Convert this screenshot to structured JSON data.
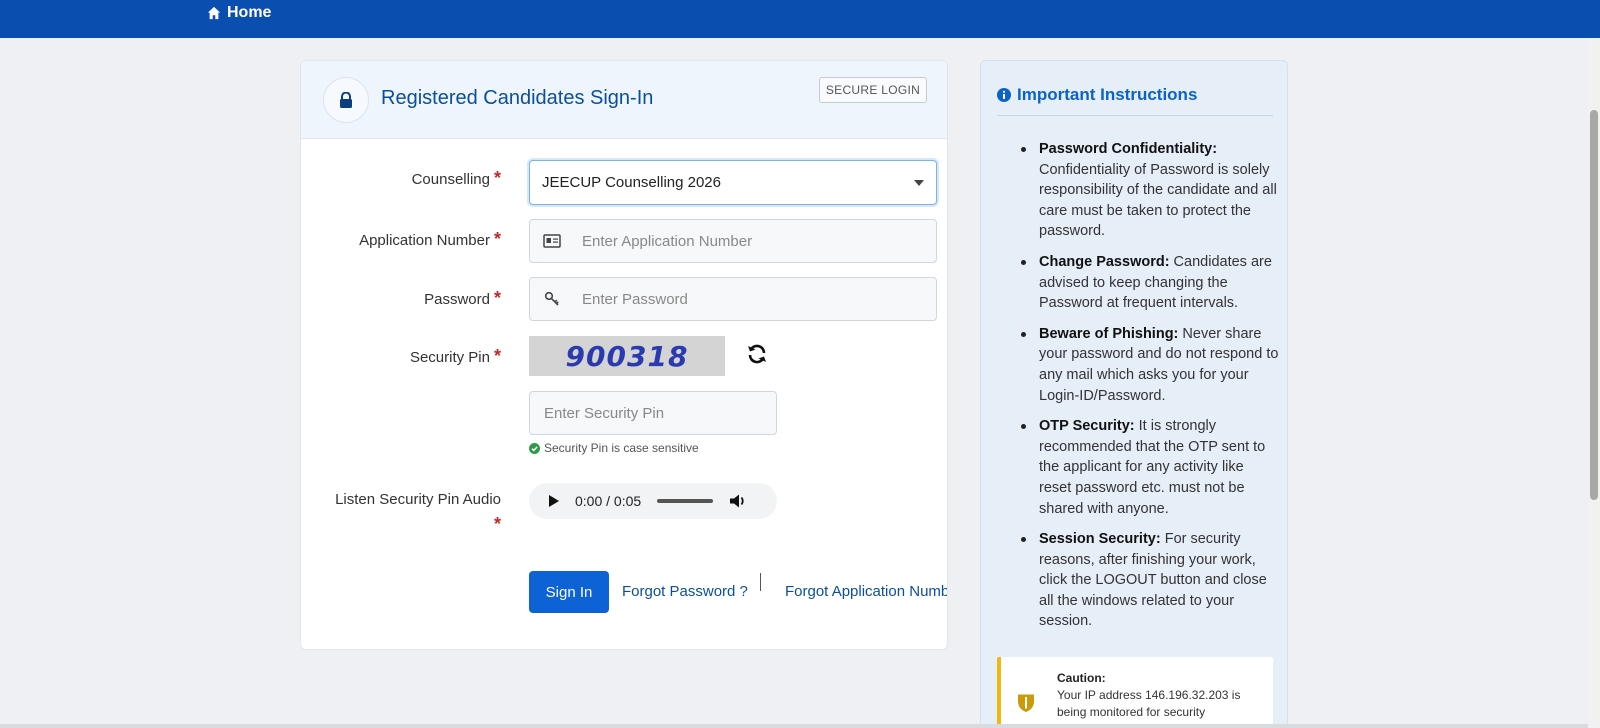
{
  "nav": {
    "home_label": "Home"
  },
  "signin": {
    "title": "Registered Candidates Sign-In",
    "badge": "SECURE LOGIN",
    "counselling_label": "Counselling",
    "counselling_value": "JEECUP Counselling 2026",
    "application_label": "Application Number",
    "application_placeholder": "Enter Application Number",
    "password_label": "Password",
    "password_placeholder": "Enter Password",
    "pin_label": "Security Pin",
    "captcha_text": "900318",
    "pin_placeholder": "Enter Security Pin",
    "pin_hint": "Security Pin is case sensitive",
    "audio_label": "Listen Security Pin Audio",
    "audio_time": "0:00 / 0:05",
    "required_mark": "*",
    "signin_button": "Sign In",
    "forgot_password": "Forgot Password ?",
    "forgot_application": "Forgot Application Numbe"
  },
  "instructions": {
    "title": "Important Instructions",
    "items": [
      {
        "heading": "Password Confidentiality:",
        "text": " Confidentiality of Password is solely responsibility of the candidate and all care must be taken to protect the password."
      },
      {
        "heading": "Change Password:",
        "text": " Candidates are advised to keep changing the Password at frequent intervals."
      },
      {
        "heading": "Beware of Phishing:",
        "text": " Never share your password and do not respond to any mail which asks you for your Login-ID/Password."
      },
      {
        "heading": "OTP Security:",
        "text": " It is strongly recommended that the OTP sent to the applicant for any activity like reset password etc. must not be shared with anyone."
      },
      {
        "heading": "Session Security:",
        "text": " For security reasons, after finishing your work, click the LOGOUT button and close all the windows related to your session."
      }
    ],
    "caution_title": "Caution:",
    "caution_text": "Your IP address 146.196.32.203 is being monitored for security"
  },
  "colors": {
    "topbar": "#0a4fb0",
    "primary_button": "#0d63d6",
    "link": "#0b4f9c",
    "required": "#c0272d",
    "caution_accent": "#f0b90b"
  },
  "icons": {
    "home": "home-icon",
    "lock": "lock-icon",
    "id_card": "id-card-icon",
    "key": "key-icon",
    "refresh": "refresh-icon",
    "check": "check-circle-icon",
    "play": "play-icon",
    "volume": "volume-icon",
    "info": "info-circle-icon",
    "shield": "shield-icon"
  }
}
